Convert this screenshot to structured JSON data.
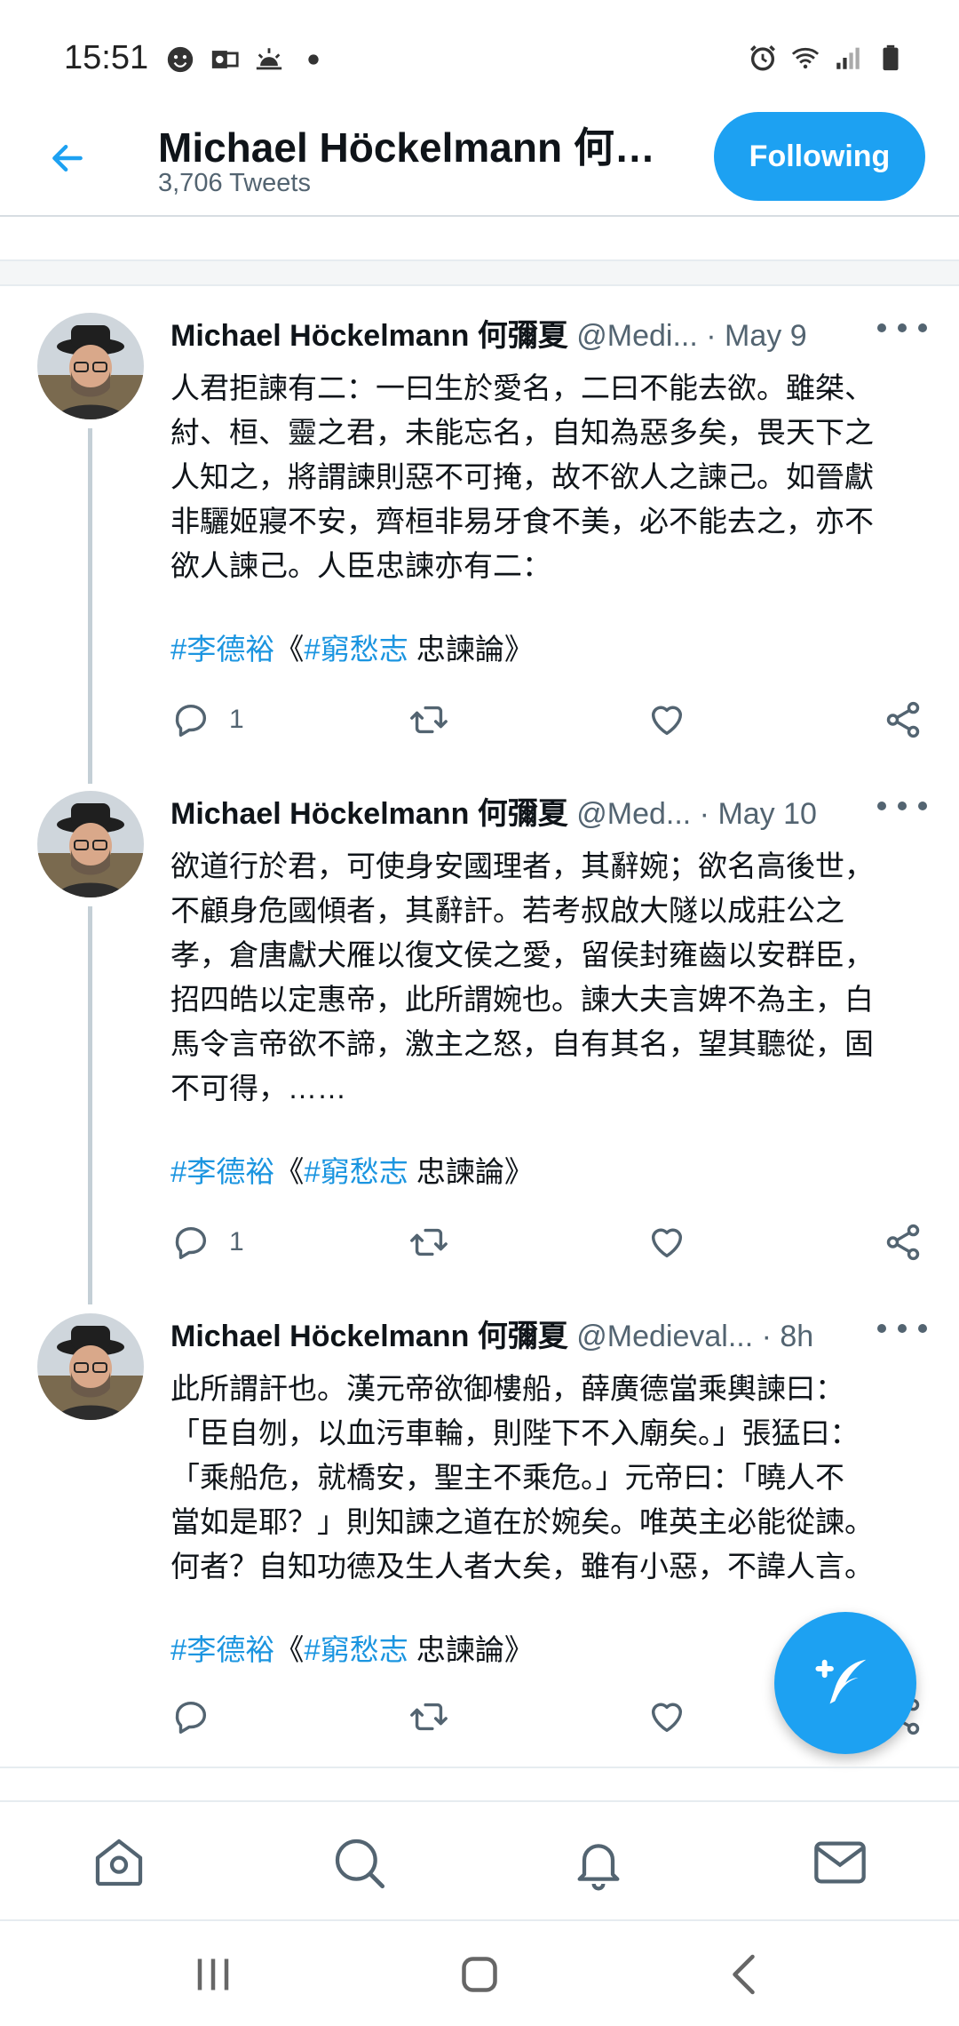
{
  "status_bar": {
    "time": "15:51",
    "left_icons": [
      "smiley-icon",
      "outlook-icon",
      "sunrise-icon",
      "dot-icon"
    ],
    "right_icons": [
      "alarm-icon",
      "wifi-icon",
      "signal-icon",
      "battery-icon"
    ]
  },
  "header": {
    "title": "Michael Höckelmann 何彌夏",
    "subtitle": "3,706 Tweets",
    "follow_label": "Following",
    "accent_color": "#1da1f2"
  },
  "tweets": [
    {
      "name": "Michael Höckelmann 何彌夏",
      "handle": "@Medi...",
      "separator": " · ",
      "date": "May 9",
      "text": "人君拒諫有二：一曰生於愛名，二曰不能去欲。雖桀、\n紂、桓、靈之君，未能忘名，自知為惡多矣，畏天下之\n人知之，將謂諫則惡不可掩，故不欲人之諫己。如晉獻\n非驪姬寢不安，齊桓非易牙食不美，必不能去之，亦不\n欲人諫己。人臣忠諫亦有二：",
      "tag1": "#李德裕",
      "bracket_open": "《",
      "tag2": "#窮愁志",
      "tail": " 忠諫論》",
      "reply_count": "1"
    },
    {
      "name": "Michael Höckelmann 何彌夏",
      "handle": "@Med...",
      "separator": " · ",
      "date": "May 10",
      "text": "欲道行於君，可使身安國理者，其辭婉；欲名高後世，\n不顧身危國傾者，其辭訐。若考叔啟大隧以成莊公之\n孝，倉唐獻犬雁以復文侯之愛，留侯封雍齒以安群臣，\n招四皓以定惠帝，此所謂婉也。諫大夫言婢不為主，白\n馬令言帝欲不諦，激主之怒，自有其名，望其聽從，固\n不可得，……",
      "tag1": "#李德裕",
      "bracket_open": "《",
      "tag2": "#窮愁志",
      "tail": " 忠諫論》",
      "reply_count": "1"
    },
    {
      "name": "Michael Höckelmann 何彌夏",
      "handle": "@Medieval...",
      "separator": " · ",
      "date": "8h",
      "text": "此所謂訐也。漢元帝欲御樓船，薛廣德當乘輿諫曰：\n「臣自刎，以血污車輪，則陛下不入廟矣。」張猛曰：\n「乘船危，就橋安，聖主不乘危。」元帝曰：「曉人不\n當如是耶？」則知諫之道在於婉矣。唯英主必能從諫。\n何者？自知功德及生人者大矣，雖有小惡，不諱人言。",
      "tag1": "#李德裕",
      "bracket_open": "《",
      "tag2": "#窮愁志",
      "tail": " 忠諫論》",
      "reply_count": ""
    }
  ],
  "fab": {
    "icon": "compose-tweet-icon"
  },
  "bottom_nav": [
    "home-icon",
    "search-icon",
    "notifications-icon",
    "messages-icon"
  ],
  "system_nav": [
    "recent-apps-icon",
    "home-button-icon",
    "back-icon"
  ]
}
